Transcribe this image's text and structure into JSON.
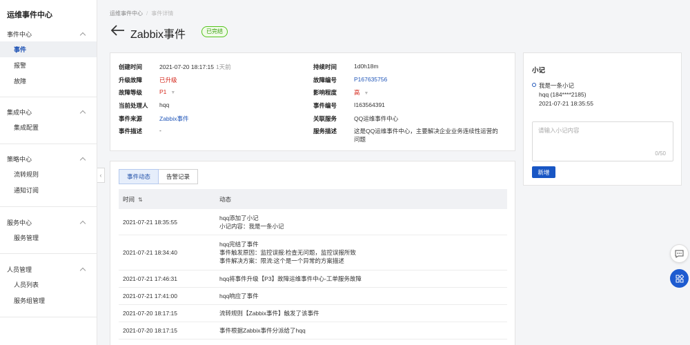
{
  "sidebar": {
    "title": "运维事件中心",
    "groups": [
      {
        "label": "事件中心",
        "items": [
          "事件",
          "报警",
          "故障"
        ]
      },
      {
        "label": "集成中心",
        "items": [
          "集成配置"
        ]
      },
      {
        "label": "策略中心",
        "items": [
          "流转规则",
          "通知订阅"
        ]
      },
      {
        "label": "服务中心",
        "items": [
          "服务管理"
        ]
      },
      {
        "label": "人员管理",
        "items": [
          "人员列表",
          "服务组管理"
        ]
      }
    ],
    "active_item": "事件"
  },
  "breadcrumb": {
    "root": "运维事件中心",
    "current": "事件详情"
  },
  "header": {
    "title": "Zabbix事件",
    "status": "已完结"
  },
  "info": {
    "create_time_label": "创建时间",
    "create_time": "2021-07-20 18:17:15",
    "create_time_ago": "1天前",
    "upgrade_label": "升级故障",
    "upgrade": "已升级",
    "fault_level_label": "故障等级",
    "fault_level": "P1",
    "handler_label": "当前处理人",
    "handler": "hqq",
    "source_label": "事件来源",
    "source": "Zabbix事件",
    "desc_label": "事件描述",
    "desc": "-",
    "duration_label": "持续时间",
    "duration": "1d0h18m",
    "fault_no_label": "故障编号",
    "fault_no": "P167635756",
    "impact_label": "影响程度",
    "impact": "高",
    "event_no_label": "事件编号",
    "event_no": "I163564391",
    "service_label": "关联服务",
    "service": "QQ运维事件中心",
    "service_desc_label": "服务描述",
    "service_desc_line1": "这是QQ运维事件中心，主要解决企业业务连续性运营的",
    "service_desc_line2": "问题"
  },
  "tabs": [
    "事件动态",
    "告警记录"
  ],
  "table": {
    "col_time": "时间",
    "col_activity": "动态",
    "rows": [
      {
        "time": "2021-07-21 18:35:55",
        "lines": [
          "hqq添加了小记",
          "小记内容：我是一条小记"
        ]
      },
      {
        "time": "2021-07-21 18:34:40",
        "lines": [
          "hqq完结了事件",
          "事件触发原因：监控误报:检查无问题，监控误报所致",
          "事件解决方案：限流:这个是一个异常的方案描述"
        ]
      },
      {
        "time": "2021-07-21 17:46:31",
        "lines": [
          "hqq将事件升级【P3】故障运维事件中心-工单服务故障"
        ]
      },
      {
        "time": "2021-07-21 17:41:00",
        "lines": [
          "hqq响应了事件"
        ]
      },
      {
        "time": "2021-07-20 18:17:15",
        "lines": [
          "流转规则【Zabbix事件】触发了该事件"
        ]
      },
      {
        "time": "2021-07-20 18:17:15",
        "lines": [
          "事件根据Zabbix事件分派给了hqq"
        ]
      }
    ]
  },
  "note": {
    "title": "小记",
    "entry_text": "我是一条小记",
    "entry_user": "hqq (184****2185)",
    "entry_time": "2021-07-21 18:35:55",
    "placeholder": "请输入小记内容",
    "counter": "0/50",
    "add_label": "新增"
  },
  "colors": {
    "primary": "#1856c4",
    "danger": "#d4281c",
    "success": "#389e0d"
  }
}
